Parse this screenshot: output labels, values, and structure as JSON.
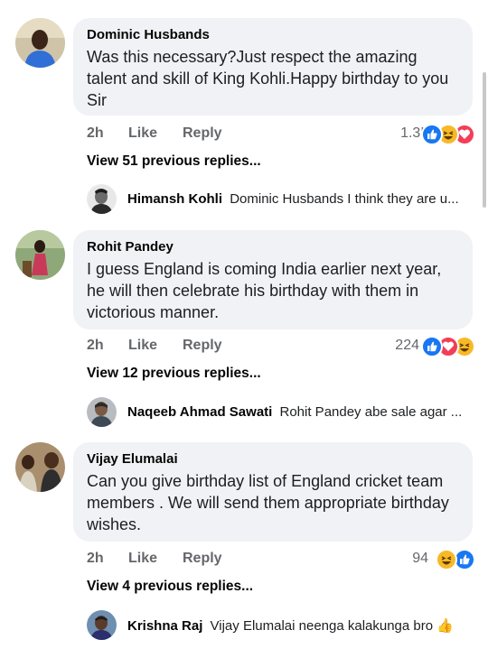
{
  "comments": [
    {
      "author": "Dominic Husbands",
      "text": "Was this necessary?Just respect the amazing talent and skill of King Kohli.Happy birthday to you Sir",
      "time": "2h",
      "like_label": "Like",
      "reply_label": "Reply",
      "reaction_count": "1.3K",
      "reactions": [
        "like-icon",
        "haha-icon",
        "love-icon"
      ],
      "view_replies": "View 51 previous replies...",
      "reply": {
        "author": "Himansh Kohli",
        "text": "Dominic Husbands I think they are u..."
      }
    },
    {
      "author": "Rohit Pandey",
      "text": "I guess England is coming India earlier next year, he will then celebrate his birthday with them in victorious manner.",
      "time": "2h",
      "like_label": "Like",
      "reply_label": "Reply",
      "reaction_count": "224",
      "reactions": [
        "like-icon",
        "love-icon",
        "haha-icon"
      ],
      "view_replies": "View 12 previous replies...",
      "reply": {
        "author": "Naqeeb Ahmad Sawati",
        "text": "Rohit Pandey abe sale agar ..."
      }
    },
    {
      "author": "Vijay Elumalai",
      "text": "Can you give birthday list of England cricket team members  . We will send  them appropriate birthday wishes.",
      "time": "2h",
      "like_label": "Like",
      "reply_label": "Reply",
      "reaction_count": "94",
      "reactions": [
        "haha-icon",
        "like-icon"
      ],
      "view_replies": "View 4 previous replies...",
      "reply": {
        "author": "Krishna Raj",
        "text": "Vijay Elumalai  neenga kalakunga bro 👍"
      }
    }
  ],
  "colors": {
    "bubble": "#f0f2f5",
    "like": "#1877f2",
    "haha": "#f7b928",
    "love": "#f33e58",
    "meta": "#65676b"
  }
}
